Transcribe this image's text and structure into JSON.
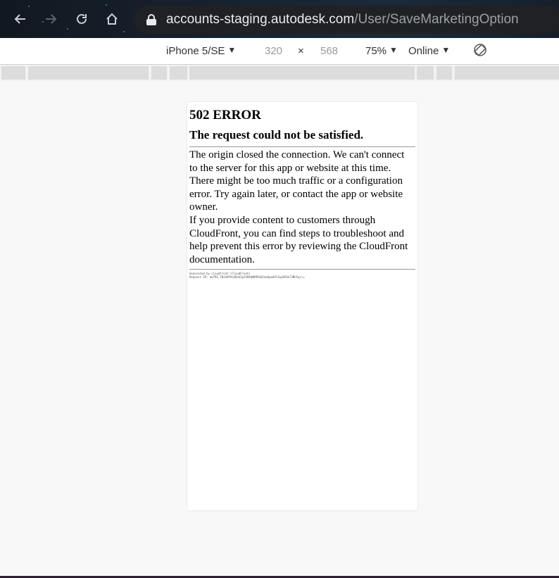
{
  "browser": {
    "url_domain": "accounts-staging.autodesk.com",
    "url_path": "/User/SaveMarketingOption",
    "back_icon": "arrow-left-icon",
    "forward_icon": "arrow-right-icon",
    "reload_icon": "reload-icon",
    "home_icon": "home-icon"
  },
  "device_toolbar": {
    "device": "iPhone 5/SE",
    "width": "320",
    "times": "×",
    "height": "568",
    "zoom": "75%",
    "network": "Online",
    "caret": "▼",
    "rotate_icon": "rotate-icon"
  },
  "page": {
    "heading": "502 ERROR",
    "subheading": "The request could not be satisfied.",
    "paragraph1": "The origin closed the connection. We can't connect to the server for this app or website at this time. There might be too much traffic or a configuration error. Try again later, or contact the app or website owner.",
    "paragraph2": "If you provide content to customers through CloudFront, you can find steps to troubleshoot and help prevent this error by reviewing the CloudFront documentation.",
    "footer_line1": "Generated by cloudfront (CloudFront)",
    "footer_line2": "Request ID: mwTRS_TWJdXPAa3DaAIgTeR8dWK9RnQ1mxUpwdUlXayW5Sm73NhFgr=="
  },
  "colors": {
    "topbar_bg": "#17222f",
    "omnibox_bg": "#202124",
    "page_bg": "#f8f8f8"
  }
}
